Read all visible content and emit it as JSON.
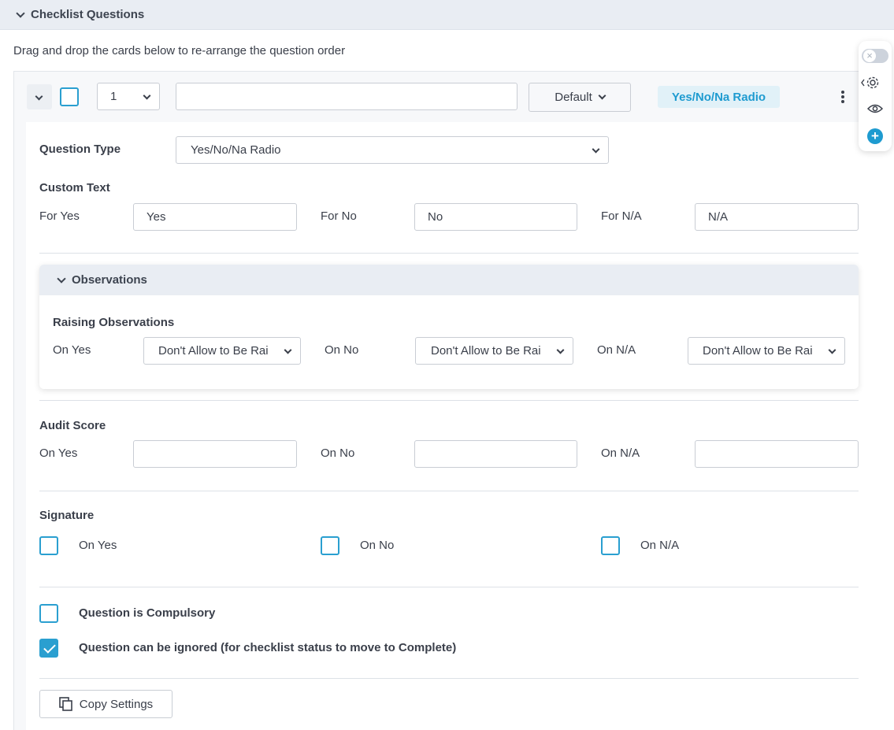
{
  "section": {
    "title": "Checklist Questions"
  },
  "hint": "Drag and drop the cards below to re-arrange the question order",
  "card_header": {
    "order_value": "1",
    "question_text": "",
    "default_label": "Default",
    "type_badge": "Yes/No/Na Radio"
  },
  "question_type": {
    "label": "Question Type",
    "value": "Yes/No/Na Radio"
  },
  "custom_text": {
    "heading": "Custom Text",
    "for_yes_label": "For Yes",
    "for_yes_value": "Yes",
    "for_no_label": "For No",
    "for_no_value": "No",
    "for_na_label": "For N/A",
    "for_na_value": "N/A"
  },
  "observations": {
    "title": "Observations",
    "heading": "Raising Observations",
    "on_yes_label": "On Yes",
    "on_yes_value": "Don't Allow to Be Rai",
    "on_no_label": "On No",
    "on_no_value": "Don't Allow to Be Rai",
    "on_na_label": "On N/A",
    "on_na_value": "Don't Allow to Be Rai"
  },
  "audit_score": {
    "heading": "Audit Score",
    "on_yes_label": "On Yes",
    "on_yes_value": "",
    "on_no_label": "On No",
    "on_no_value": "",
    "on_na_label": "On N/A",
    "on_na_value": ""
  },
  "signature": {
    "heading": "Signature",
    "on_yes_label": "On Yes",
    "on_no_label": "On No",
    "on_na_label": "On N/A"
  },
  "compulsory": {
    "label": "Question is Compulsory",
    "checked": false
  },
  "ignorable": {
    "label": "Question can be ignored (for checklist status to move to Complete)",
    "checked": true
  },
  "copy_settings": {
    "label": "Copy Settings"
  },
  "colors": {
    "accent": "#2a9fd0",
    "header_bg": "#e9edf3"
  }
}
